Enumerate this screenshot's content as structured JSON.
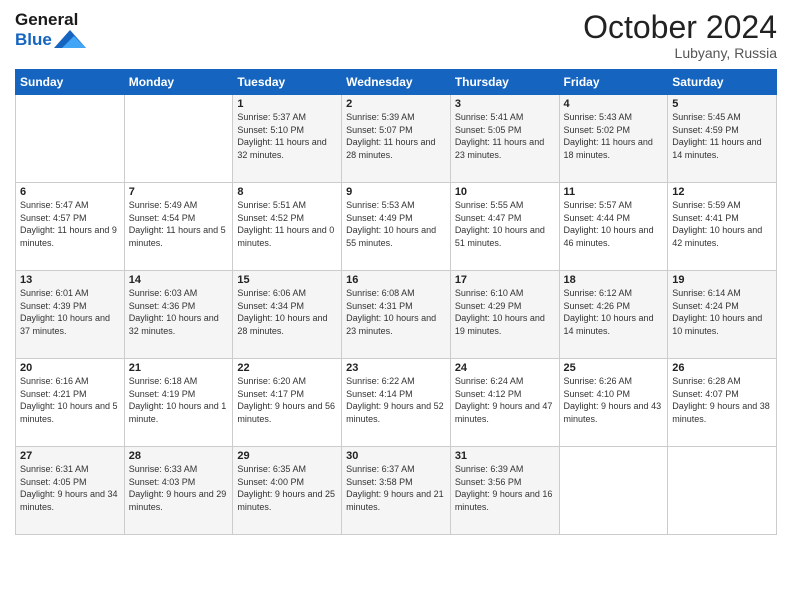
{
  "header": {
    "logo_line1": "General",
    "logo_line2": "Blue",
    "month": "October 2024",
    "location": "Lubyany, Russia"
  },
  "weekdays": [
    "Sunday",
    "Monday",
    "Tuesday",
    "Wednesday",
    "Thursday",
    "Friday",
    "Saturday"
  ],
  "weeks": [
    [
      {
        "day": "",
        "sunrise": "",
        "sunset": "",
        "daylight": ""
      },
      {
        "day": "",
        "sunrise": "",
        "sunset": "",
        "daylight": ""
      },
      {
        "day": "1",
        "sunrise": "Sunrise: 5:37 AM",
        "sunset": "Sunset: 5:10 PM",
        "daylight": "Daylight: 11 hours and 32 minutes."
      },
      {
        "day": "2",
        "sunrise": "Sunrise: 5:39 AM",
        "sunset": "Sunset: 5:07 PM",
        "daylight": "Daylight: 11 hours and 28 minutes."
      },
      {
        "day": "3",
        "sunrise": "Sunrise: 5:41 AM",
        "sunset": "Sunset: 5:05 PM",
        "daylight": "Daylight: 11 hours and 23 minutes."
      },
      {
        "day": "4",
        "sunrise": "Sunrise: 5:43 AM",
        "sunset": "Sunset: 5:02 PM",
        "daylight": "Daylight: 11 hours and 18 minutes."
      },
      {
        "day": "5",
        "sunrise": "Sunrise: 5:45 AM",
        "sunset": "Sunset: 4:59 PM",
        "daylight": "Daylight: 11 hours and 14 minutes."
      }
    ],
    [
      {
        "day": "6",
        "sunrise": "Sunrise: 5:47 AM",
        "sunset": "Sunset: 4:57 PM",
        "daylight": "Daylight: 11 hours and 9 minutes."
      },
      {
        "day": "7",
        "sunrise": "Sunrise: 5:49 AM",
        "sunset": "Sunset: 4:54 PM",
        "daylight": "Daylight: 11 hours and 5 minutes."
      },
      {
        "day": "8",
        "sunrise": "Sunrise: 5:51 AM",
        "sunset": "Sunset: 4:52 PM",
        "daylight": "Daylight: 11 hours and 0 minutes."
      },
      {
        "day": "9",
        "sunrise": "Sunrise: 5:53 AM",
        "sunset": "Sunset: 4:49 PM",
        "daylight": "Daylight: 10 hours and 55 minutes."
      },
      {
        "day": "10",
        "sunrise": "Sunrise: 5:55 AM",
        "sunset": "Sunset: 4:47 PM",
        "daylight": "Daylight: 10 hours and 51 minutes."
      },
      {
        "day": "11",
        "sunrise": "Sunrise: 5:57 AM",
        "sunset": "Sunset: 4:44 PM",
        "daylight": "Daylight: 10 hours and 46 minutes."
      },
      {
        "day": "12",
        "sunrise": "Sunrise: 5:59 AM",
        "sunset": "Sunset: 4:41 PM",
        "daylight": "Daylight: 10 hours and 42 minutes."
      }
    ],
    [
      {
        "day": "13",
        "sunrise": "Sunrise: 6:01 AM",
        "sunset": "Sunset: 4:39 PM",
        "daylight": "Daylight: 10 hours and 37 minutes."
      },
      {
        "day": "14",
        "sunrise": "Sunrise: 6:03 AM",
        "sunset": "Sunset: 4:36 PM",
        "daylight": "Daylight: 10 hours and 32 minutes."
      },
      {
        "day": "15",
        "sunrise": "Sunrise: 6:06 AM",
        "sunset": "Sunset: 4:34 PM",
        "daylight": "Daylight: 10 hours and 28 minutes."
      },
      {
        "day": "16",
        "sunrise": "Sunrise: 6:08 AM",
        "sunset": "Sunset: 4:31 PM",
        "daylight": "Daylight: 10 hours and 23 minutes."
      },
      {
        "day": "17",
        "sunrise": "Sunrise: 6:10 AM",
        "sunset": "Sunset: 4:29 PM",
        "daylight": "Daylight: 10 hours and 19 minutes."
      },
      {
        "day": "18",
        "sunrise": "Sunrise: 6:12 AM",
        "sunset": "Sunset: 4:26 PM",
        "daylight": "Daylight: 10 hours and 14 minutes."
      },
      {
        "day": "19",
        "sunrise": "Sunrise: 6:14 AM",
        "sunset": "Sunset: 4:24 PM",
        "daylight": "Daylight: 10 hours and 10 minutes."
      }
    ],
    [
      {
        "day": "20",
        "sunrise": "Sunrise: 6:16 AM",
        "sunset": "Sunset: 4:21 PM",
        "daylight": "Daylight: 10 hours and 5 minutes."
      },
      {
        "day": "21",
        "sunrise": "Sunrise: 6:18 AM",
        "sunset": "Sunset: 4:19 PM",
        "daylight": "Daylight: 10 hours and 1 minute."
      },
      {
        "day": "22",
        "sunrise": "Sunrise: 6:20 AM",
        "sunset": "Sunset: 4:17 PM",
        "daylight": "Daylight: 9 hours and 56 minutes."
      },
      {
        "day": "23",
        "sunrise": "Sunrise: 6:22 AM",
        "sunset": "Sunset: 4:14 PM",
        "daylight": "Daylight: 9 hours and 52 minutes."
      },
      {
        "day": "24",
        "sunrise": "Sunrise: 6:24 AM",
        "sunset": "Sunset: 4:12 PM",
        "daylight": "Daylight: 9 hours and 47 minutes."
      },
      {
        "day": "25",
        "sunrise": "Sunrise: 6:26 AM",
        "sunset": "Sunset: 4:10 PM",
        "daylight": "Daylight: 9 hours and 43 minutes."
      },
      {
        "day": "26",
        "sunrise": "Sunrise: 6:28 AM",
        "sunset": "Sunset: 4:07 PM",
        "daylight": "Daylight: 9 hours and 38 minutes."
      }
    ],
    [
      {
        "day": "27",
        "sunrise": "Sunrise: 6:31 AM",
        "sunset": "Sunset: 4:05 PM",
        "daylight": "Daylight: 9 hours and 34 minutes."
      },
      {
        "day": "28",
        "sunrise": "Sunrise: 6:33 AM",
        "sunset": "Sunset: 4:03 PM",
        "daylight": "Daylight: 9 hours and 29 minutes."
      },
      {
        "day": "29",
        "sunrise": "Sunrise: 6:35 AM",
        "sunset": "Sunset: 4:00 PM",
        "daylight": "Daylight: 9 hours and 25 minutes."
      },
      {
        "day": "30",
        "sunrise": "Sunrise: 6:37 AM",
        "sunset": "Sunset: 3:58 PM",
        "daylight": "Daylight: 9 hours and 21 minutes."
      },
      {
        "day": "31",
        "sunrise": "Sunrise: 6:39 AM",
        "sunset": "Sunset: 3:56 PM",
        "daylight": "Daylight: 9 hours and 16 minutes."
      },
      {
        "day": "",
        "sunrise": "",
        "sunset": "",
        "daylight": ""
      },
      {
        "day": "",
        "sunrise": "",
        "sunset": "",
        "daylight": ""
      }
    ]
  ]
}
